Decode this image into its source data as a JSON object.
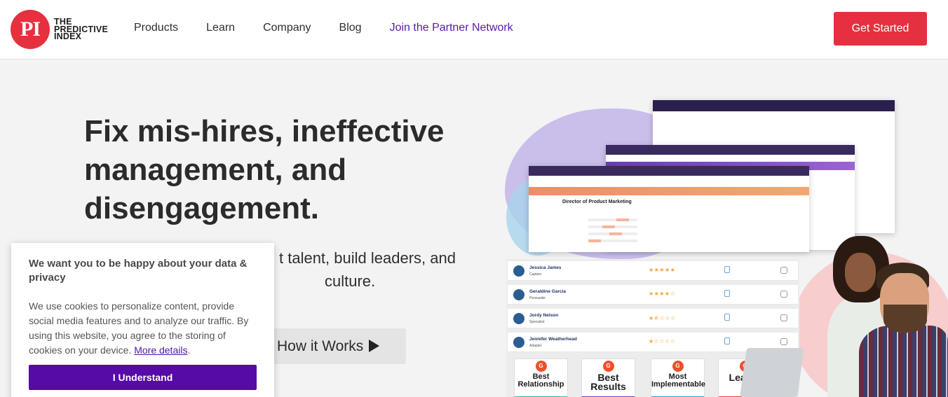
{
  "logo": {
    "mark": "PI",
    "line1": "THE",
    "line2": "PREDICTIVE",
    "line3": "INDEX"
  },
  "nav": [
    "Products",
    "Learn",
    "Company",
    "Blog",
    "Join the Partner Network"
  ],
  "header": {
    "cta": "Get Started"
  },
  "hero": {
    "title": "Fix mis-hires, ineffective management, and disengagement.",
    "subtitle_visible": "t talent, build leaders, and",
    "subtitle_visible2": "culture.",
    "how_button": "How it Works"
  },
  "app_mock": {
    "job_title": "Director of Product Marketing",
    "candidates": [
      {
        "name": "Jessica James",
        "role": "Captain",
        "stars": "★★★★★"
      },
      {
        "name": "Geraldine Garcia",
        "role": "Persuader",
        "stars": "★★★★☆"
      },
      {
        "name": "Jordy Nelson",
        "role": "Specialist",
        "stars": "★⯪☆☆☆"
      },
      {
        "name": "Jennifer Weatherhead",
        "role": "Adapter",
        "stars": "★☆☆☆☆"
      }
    ]
  },
  "badges": [
    {
      "label": "Best Relationship",
      "stripe": "#2fb5a0"
    },
    {
      "label": "Best Results",
      "stripe": "#6a3fc4"
    },
    {
      "label": "Most Implementable",
      "stripe": "#2f9fd4"
    },
    {
      "label": "Leader",
      "stripe": "#e6452b"
    }
  ],
  "cookie": {
    "title": "We want you to be happy about your data & privacy",
    "body": "We use cookies to personalize content, provide social media features and to analyze our traffic. By using this website, you agree to the storing of cookies on your device.",
    "link": "More details",
    "period": ".",
    "button": "I Understand"
  },
  "colors": {
    "brand_red": "#e6303f",
    "brand_purple": "#560aa6"
  }
}
